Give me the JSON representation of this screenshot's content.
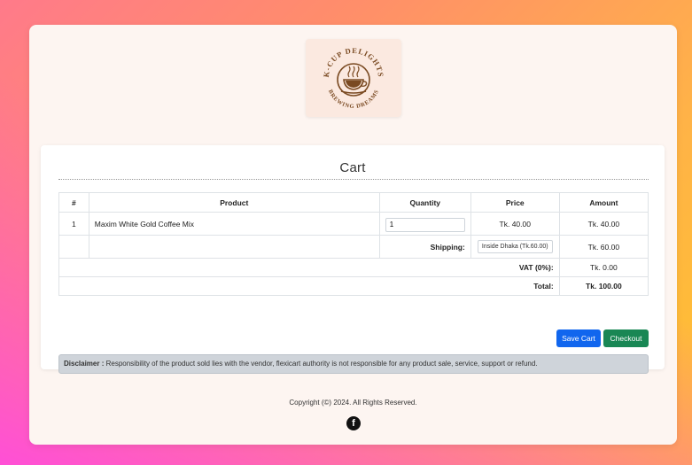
{
  "logo": {
    "top_text": "K-CUP DELIGHTS",
    "bottom_text": "BREWING DREAMS"
  },
  "cart": {
    "title": "Cart",
    "columns": [
      "#",
      "Product",
      "Quantity",
      "Price",
      "Amount"
    ],
    "items": [
      {
        "index": "1",
        "product": "Maxim White Gold Coffee Mix",
        "quantity": "1",
        "price": "Tk. 40.00",
        "amount": "Tk. 40.00"
      }
    ],
    "shipping": {
      "label": "Shipping:",
      "selected": "Inside Dhaka (Tk.60.00)",
      "amount": "Tk. 60.00"
    },
    "vat": {
      "label": "VAT (0%):",
      "amount": "Tk. 0.00"
    },
    "total": {
      "label": "Total:",
      "amount": "Tk. 100.00"
    },
    "buttons": {
      "save": "Save Cart",
      "checkout": "Checkout"
    },
    "disclaimer": {
      "label": "Disclaimer :",
      "text": "Responsibility of the product sold lies with the vendor, flexicart authority is not responsible for any product sale, service, support or refund."
    }
  },
  "footer": {
    "copyright": "Copyright (©) 2024. All Rights Reserved.",
    "social_icon": "facebook-icon",
    "social_glyph": "f"
  },
  "colors": {
    "primary": "#1166ee",
    "success": "#198754",
    "logo_brown": "#7a4a22"
  }
}
